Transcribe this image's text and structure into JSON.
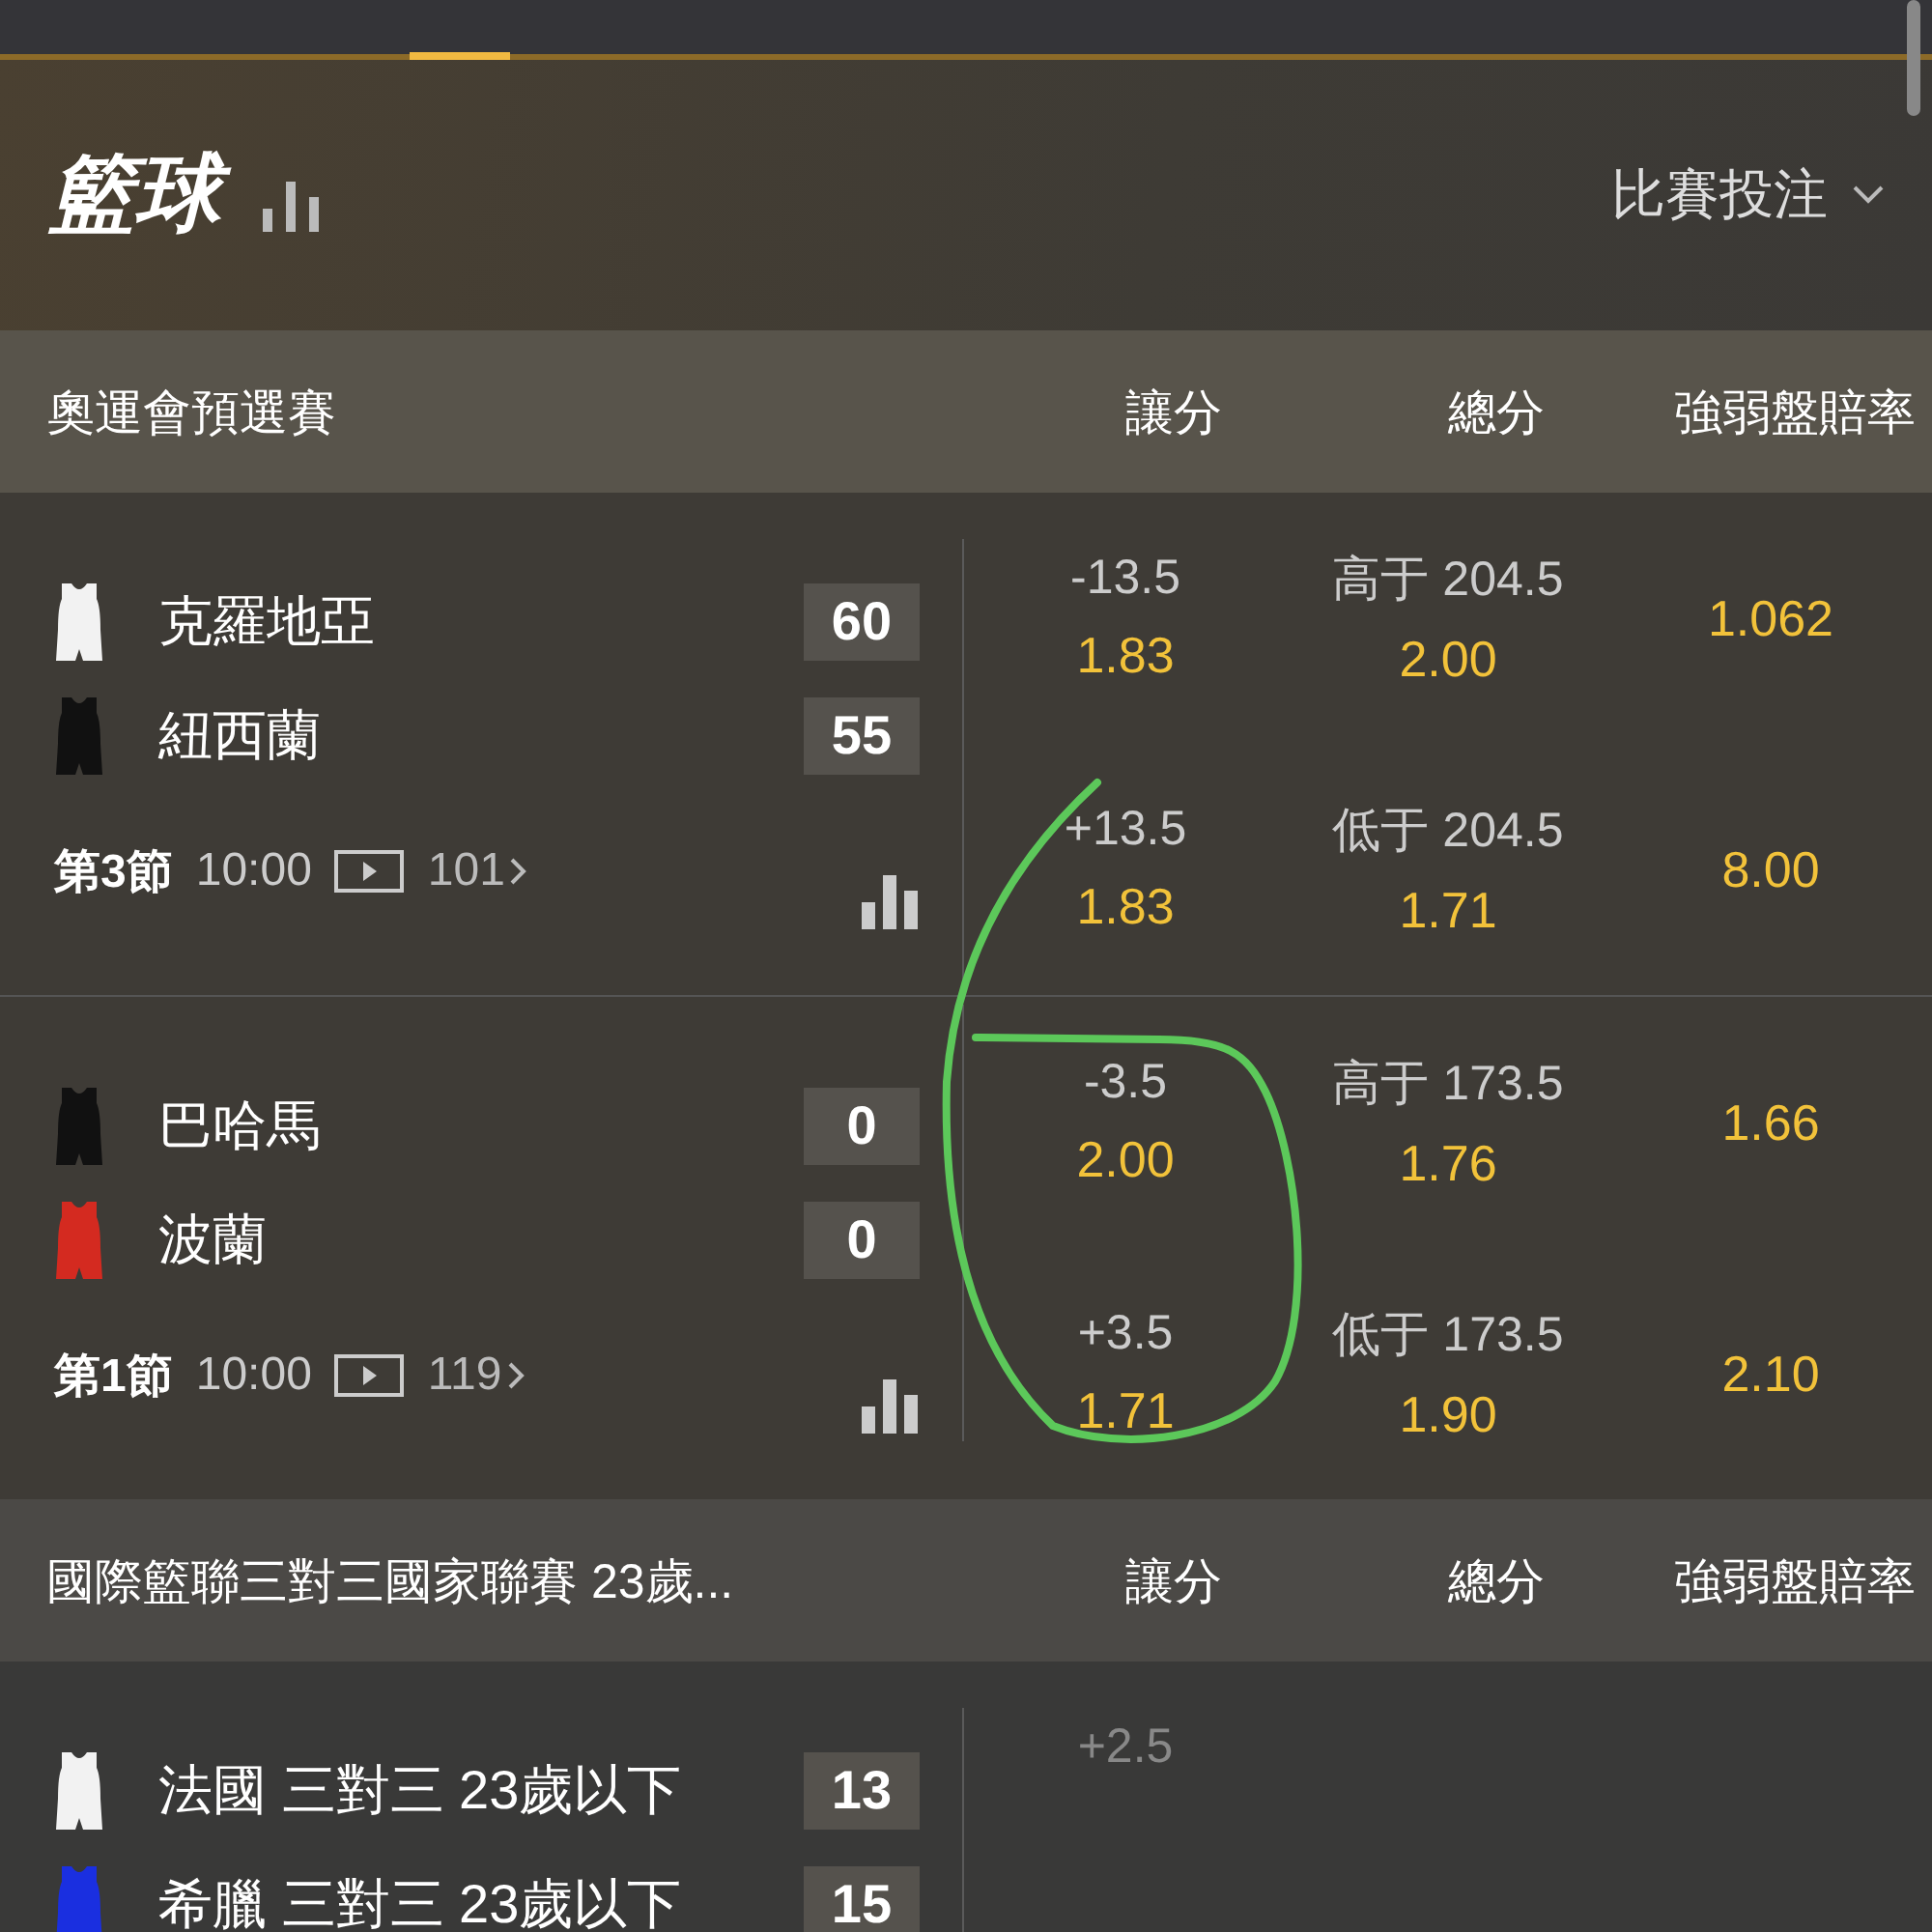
{
  "header": {
    "title": "籃球",
    "menu": "比賽投注"
  },
  "leagues": [
    {
      "name": "奧運會預選賽",
      "columns": [
        "讓分",
        "總分",
        "強弱盤賠率"
      ],
      "matches": [
        {
          "teams": [
            {
              "name": "克羅地亞",
              "score": "60",
              "color": "#f2f2f2"
            },
            {
              "name": "紐西蘭",
              "score": "55",
              "color": "#111111"
            }
          ],
          "period": "第3節",
          "clock": "10:00",
          "more": "101",
          "rows": [
            {
              "handicap": {
                "line": "-13.5",
                "price": "1.83"
              },
              "total": {
                "line": "高于 204.5",
                "price": "2.00"
              },
              "moneyline": "1.062"
            },
            {
              "handicap": {
                "line": "+13.5",
                "price": "1.83"
              },
              "total": {
                "line": "低于 204.5",
                "price": "1.71"
              },
              "moneyline": "8.00"
            }
          ]
        },
        {
          "teams": [
            {
              "name": "巴哈馬",
              "score": "0",
              "color": "#111111"
            },
            {
              "name": "波蘭",
              "score": "0",
              "color": "#d42a20"
            }
          ],
          "period": "第1節",
          "clock": "10:00",
          "more": "119",
          "rows": [
            {
              "handicap": {
                "line": "-3.5",
                "price": "2.00"
              },
              "total": {
                "line": "高于 173.5",
                "price": "1.76"
              },
              "moneyline": "1.66"
            },
            {
              "handicap": {
                "line": "+3.5",
                "price": "1.71"
              },
              "total": {
                "line": "低于 173.5",
                "price": "1.90"
              },
              "moneyline": "2.10"
            }
          ]
        }
      ]
    },
    {
      "name": "國際籃聯三對三國家聯賽 23歲...",
      "columns": [
        "讓分",
        "總分",
        "強弱盤賠率"
      ],
      "matches": [
        {
          "teams": [
            {
              "name": "法國 三對三 23歲以下",
              "score": "13",
              "color": "#f2f2f2"
            },
            {
              "name": "希臘 三對三 23歲以下",
              "score": "15",
              "color": "#1a2fe0"
            }
          ],
          "rows": [
            {
              "handicap": {
                "line": "+2.5"
              }
            }
          ]
        }
      ]
    }
  ]
}
